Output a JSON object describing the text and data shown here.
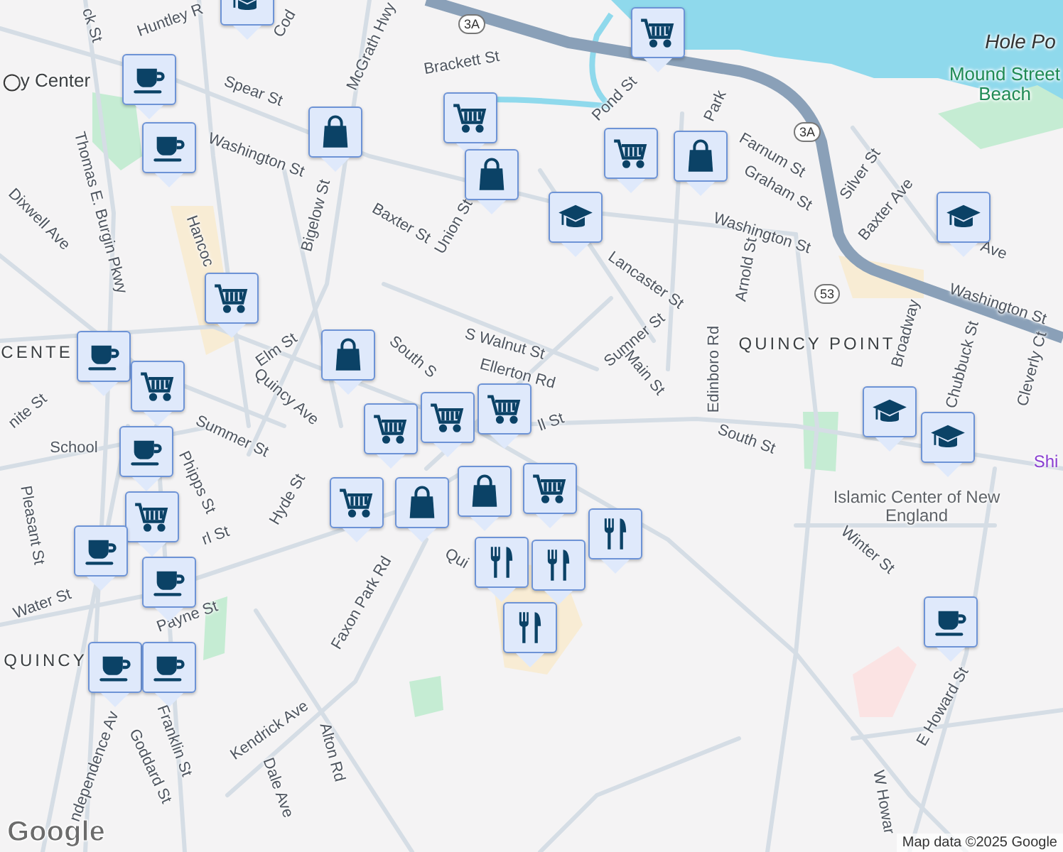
{
  "map": {
    "labels": [
      {
        "text": "ck St",
        "kind": "street"
      },
      {
        "text": "Huntley R",
        "kind": "street"
      },
      {
        "text": "Cod",
        "kind": "street"
      },
      {
        "text": "y Center",
        "kind": "station"
      },
      {
        "text": "Spear St",
        "kind": "street"
      },
      {
        "text": "McGrath Hwy",
        "kind": "street"
      },
      {
        "text": "Brackett St",
        "kind": "street"
      },
      {
        "text": "Washington St",
        "kind": "street"
      },
      {
        "text": "Thomas E. Burgin Pkwy",
        "kind": "street"
      },
      {
        "text": "Dixwell Ave",
        "kind": "street"
      },
      {
        "text": "Hancoc",
        "kind": "street"
      },
      {
        "text": "Bigelow St",
        "kind": "street"
      },
      {
        "text": "Baxter St",
        "kind": "street"
      },
      {
        "text": "Union St",
        "kind": "street"
      },
      {
        "text": "Pond St",
        "kind": "street"
      },
      {
        "text": "Park",
        "kind": "street"
      },
      {
        "text": "Farnum St",
        "kind": "street"
      },
      {
        "text": "Graham St",
        "kind": "street"
      },
      {
        "text": "Silver St",
        "kind": "street"
      },
      {
        "text": "Baxter Ave",
        "kind": "street"
      },
      {
        "text": "Washington St",
        "kind": "street"
      },
      {
        "text": "Lancaster St",
        "kind": "street"
      },
      {
        "text": "Ave",
        "kind": "street"
      },
      {
        "text": "Washington St",
        "kind": "street"
      },
      {
        "text": "Hole Po",
        "kind": "water"
      },
      {
        "text": "Mound Street Beach",
        "kind": "park"
      },
      {
        "text": "Arnold St",
        "kind": "street"
      },
      {
        "text": "Sumner St",
        "kind": "street"
      },
      {
        "text": "Main St",
        "kind": "street"
      },
      {
        "text": "S Walnut St",
        "kind": "street"
      },
      {
        "text": "Ellerton Rd",
        "kind": "street"
      },
      {
        "text": "Edinboro Rd",
        "kind": "street"
      },
      {
        "text": "QUINCY POINT",
        "kind": "area"
      },
      {
        "text": "Broadway",
        "kind": "street"
      },
      {
        "text": "Chubbuck St",
        "kind": "street"
      },
      {
        "text": "Cleverly Ct",
        "kind": "street"
      },
      {
        "text": "Elm St",
        "kind": "street"
      },
      {
        "text": "CENTE",
        "kind": "area"
      },
      {
        "text": "South S",
        "kind": "street"
      },
      {
        "text": "Quincy Ave",
        "kind": "street"
      },
      {
        "text": "Summer St",
        "kind": "street"
      },
      {
        "text": "ll St",
        "kind": "street"
      },
      {
        "text": "School",
        "kind": "street"
      },
      {
        "text": "Phipps St",
        "kind": "street"
      },
      {
        "text": "nite St",
        "kind": "street"
      },
      {
        "text": "Pleasant St",
        "kind": "street"
      },
      {
        "text": "Hyde St",
        "kind": "street"
      },
      {
        "text": "Water St",
        "kind": "street"
      },
      {
        "text": "rl St",
        "kind": "street"
      },
      {
        "text": "Payne St",
        "kind": "street"
      },
      {
        "text": "QUINCY",
        "kind": "area"
      },
      {
        "text": "Franklin St",
        "kind": "street"
      },
      {
        "text": "ndependence Av",
        "kind": "street"
      },
      {
        "text": "Goddard St",
        "kind": "street"
      },
      {
        "text": "Kendrick Ave",
        "kind": "street"
      },
      {
        "text": "Alton Rd",
        "kind": "street"
      },
      {
        "text": "Dale Ave",
        "kind": "street"
      },
      {
        "text": "Faxon Park Rd",
        "kind": "street"
      },
      {
        "text": "Qui",
        "kind": "street"
      },
      {
        "text": "South St",
        "kind": "street"
      },
      {
        "text": "Islamic Center of New England",
        "kind": "poi"
      },
      {
        "text": "Shi",
        "kind": "poi-link"
      },
      {
        "text": "Winter St",
        "kind": "street"
      },
      {
        "text": "E Howard St",
        "kind": "street"
      },
      {
        "text": "W Howar",
        "kind": "street"
      }
    ],
    "shields": [
      {
        "text": "3A"
      },
      {
        "text": "3A"
      },
      {
        "text": "53"
      }
    ],
    "markers": [
      {
        "kind": "school"
      },
      {
        "kind": "cart"
      },
      {
        "kind": "coffee"
      },
      {
        "kind": "coffee"
      },
      {
        "kind": "bag"
      },
      {
        "kind": "cart"
      },
      {
        "kind": "bag"
      },
      {
        "kind": "cart"
      },
      {
        "kind": "bag"
      },
      {
        "kind": "school"
      },
      {
        "kind": "school"
      },
      {
        "kind": "cart"
      },
      {
        "kind": "coffee"
      },
      {
        "kind": "bag"
      },
      {
        "kind": "cart"
      },
      {
        "kind": "cart"
      },
      {
        "kind": "cart"
      },
      {
        "kind": "cart"
      },
      {
        "kind": "cart"
      },
      {
        "kind": "bag"
      },
      {
        "kind": "coffee"
      },
      {
        "kind": "cart"
      },
      {
        "kind": "bag"
      },
      {
        "kind": "cart"
      },
      {
        "kind": "restaurant"
      },
      {
        "kind": "restaurant"
      },
      {
        "kind": "restaurant"
      },
      {
        "kind": "restaurant"
      },
      {
        "kind": "coffee"
      },
      {
        "kind": "coffee"
      },
      {
        "kind": "coffee"
      },
      {
        "kind": "coffee"
      },
      {
        "kind": "school"
      },
      {
        "kind": "school"
      },
      {
        "kind": "coffee"
      }
    ],
    "logo": "Google",
    "attribution": "Map data ©2025 Google"
  }
}
